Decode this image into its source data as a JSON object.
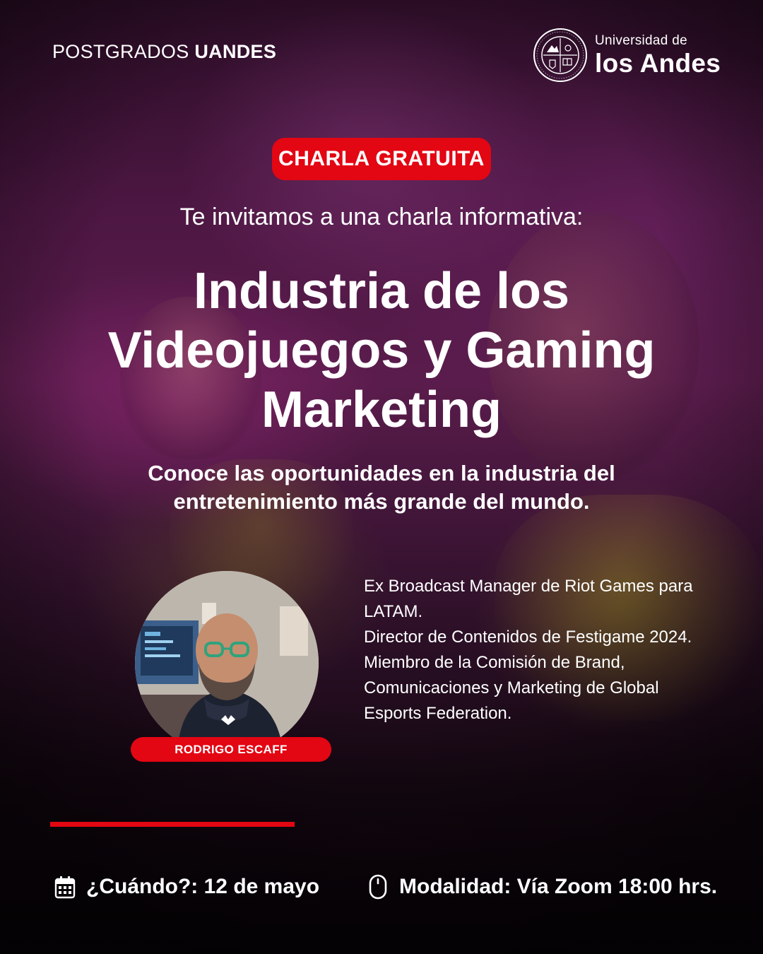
{
  "header": {
    "brand_left_light": "POSTGRADOS",
    "brand_left_bold": "UANDES",
    "university_small": "Universidad de",
    "university_big": "los Andes",
    "seal_text": "UNIVERSITAS STVDIORVM ANDINENSIS · CHILE"
  },
  "badge": "CHARLA GRATUITA",
  "invite": "Te invitamos a una charla informativa:",
  "title_lines": [
    "Industria de los",
    "Videojuegos y Gaming",
    "Marketing"
  ],
  "subtitle_lines": [
    "Conoce las oportunidades en la industria del",
    "entretenimiento más grande del mundo."
  ],
  "speaker": {
    "name": "RODRIGO ESCAFF",
    "bio_lines": [
      "Ex Broadcast Manager de Riot Games para",
      "LATAM.",
      "Director de Contenidos de Festigame 2024.",
      "Miembro de la Comisión de Brand,",
      "Comunicaciones y Marketing de Global",
      "Esports Federation."
    ]
  },
  "footer": {
    "when_icon": "calendar-icon",
    "when_text": "¿Cuándo?: 12 de mayo",
    "mode_icon": "mouse-icon",
    "mode_text": "Modalidad: Vía Zoom 18:00 hrs."
  },
  "colors": {
    "accent_red": "#e30613",
    "text": "#ffffff"
  }
}
